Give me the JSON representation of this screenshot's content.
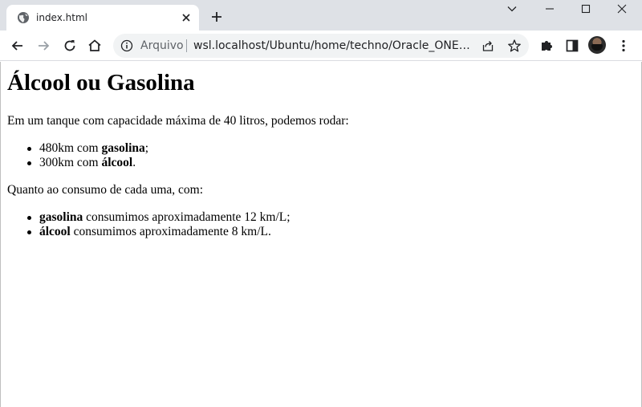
{
  "tab": {
    "title": "index.html"
  },
  "omnibox": {
    "security_label": "Arquivo",
    "url": "wsl.localhost/Ubuntu/home/techno/Oracle_ONE/oracl..."
  },
  "page": {
    "heading": "Álcool ou Gasolina",
    "intro": "Em um tanque com capacidade máxima de 40 litros, podemos rodar:",
    "range_list": [
      {
        "prefix": "480km com ",
        "bold": "gasolina",
        "suffix": ";"
      },
      {
        "prefix": "300km com ",
        "bold": "álcool",
        "suffix": "."
      }
    ],
    "consumption_intro": "Quanto ao consumo de cada uma, com:",
    "consumption_list": [
      {
        "bold": "gasolina",
        "suffix": " consumimos aproximadamente 12 km/L;"
      },
      {
        "bold": "álcool",
        "suffix": " consumimos aproximadamente 8 km/L."
      }
    ]
  },
  "colors": {
    "tabstrip_bg": "#dee1e6",
    "omnibox_bg": "#f1f3f4",
    "icon": "#5f6368"
  }
}
